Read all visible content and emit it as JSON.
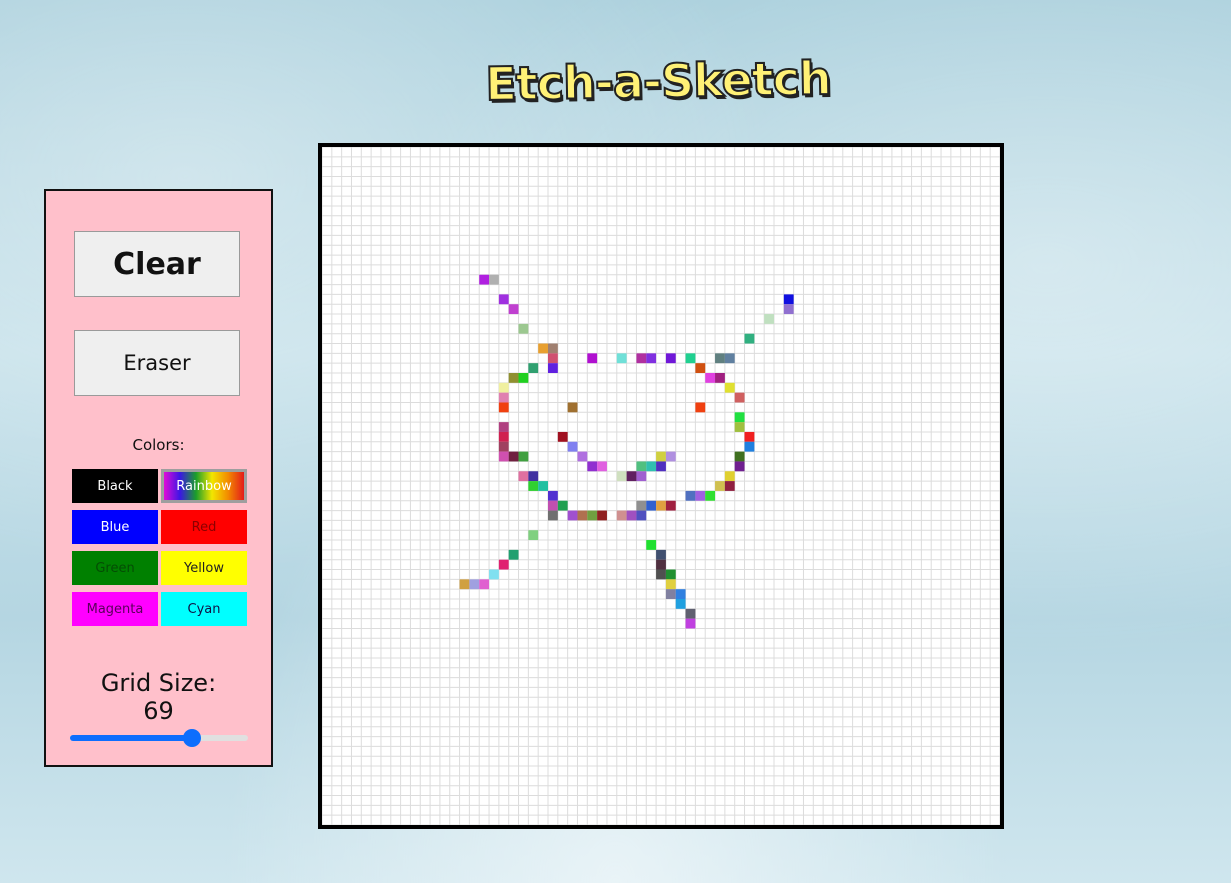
{
  "title": "Etch-a-Sketch",
  "controls": {
    "clear_label": "Clear",
    "eraser_label": "Eraser",
    "colors_label": "Colors:",
    "swatches": [
      {
        "label": "Black",
        "color": "#000000"
      },
      {
        "label": "Rainbow",
        "color": "rainbow"
      },
      {
        "label": "Blue",
        "color": "#0000ff"
      },
      {
        "label": "Red",
        "color": "#ff0000"
      },
      {
        "label": "Green",
        "color": "#008000"
      },
      {
        "label": "Yellow",
        "color": "#ffff00"
      },
      {
        "label": "Magenta",
        "color": "#ff00ff"
      },
      {
        "label": "Cyan",
        "color": "#00ffff"
      }
    ],
    "grid_size_label": "Grid Size:",
    "grid_size_value": "69",
    "slider": {
      "min": 1,
      "max": 100,
      "value": 69
    }
  },
  "board": {
    "grid_size": 69,
    "grid_line_color": "#dcdcdc",
    "painted_cells": [
      [
        16,
        13,
        "#b020e0"
      ],
      [
        17,
        13,
        "#b0b0b0"
      ],
      [
        18,
        15,
        "#a030e0"
      ],
      [
        19,
        16,
        "#c040d0"
      ],
      [
        20,
        18,
        "#9cc890"
      ],
      [
        22,
        20,
        "#e8a030"
      ],
      [
        23,
        20,
        "#a08070"
      ],
      [
        23,
        21,
        "#d05070"
      ],
      [
        27,
        21,
        "#b010d0"
      ],
      [
        30,
        21,
        "#70e0d8"
      ],
      [
        32,
        21,
        "#b030a0"
      ],
      [
        33,
        21,
        "#8030e0"
      ],
      [
        35,
        21,
        "#7018d8"
      ],
      [
        37,
        21,
        "#20d090"
      ],
      [
        40,
        21,
        "#608080"
      ],
      [
        41,
        21,
        "#6080a0"
      ],
      [
        21,
        22,
        "#30a070"
      ],
      [
        23,
        22,
        "#6020e0"
      ],
      [
        38,
        22,
        "#d05010"
      ],
      [
        19,
        23,
        "#909030"
      ],
      [
        20,
        23,
        "#20d020"
      ],
      [
        39,
        23,
        "#e040e0"
      ],
      [
        40,
        23,
        "#a02080"
      ],
      [
        18,
        24,
        "#f0f0a0"
      ],
      [
        41,
        24,
        "#e0e030"
      ],
      [
        18,
        25,
        "#e080b0"
      ],
      [
        42,
        25,
        "#d06060"
      ],
      [
        18,
        26,
        "#f04010"
      ],
      [
        25,
        26,
        "#a07030"
      ],
      [
        38,
        26,
        "#f04010"
      ],
      [
        42,
        27,
        "#20e040"
      ],
      [
        18,
        28,
        "#b04080"
      ],
      [
        42,
        28,
        "#a0c040"
      ],
      [
        18,
        29,
        "#d02050"
      ],
      [
        24,
        29,
        "#a01020"
      ],
      [
        43,
        29,
        "#f02020"
      ],
      [
        18,
        30,
        "#a04060"
      ],
      [
        25,
        30,
        "#8080f0"
      ],
      [
        43,
        30,
        "#2080e0"
      ],
      [
        18,
        31,
        "#d050b0"
      ],
      [
        19,
        31,
        "#702040"
      ],
      [
        20,
        31,
        "#40a040"
      ],
      [
        26,
        31,
        "#b070e0"
      ],
      [
        34,
        31,
        "#d0d040"
      ],
      [
        35,
        31,
        "#b090e0"
      ],
      [
        42,
        31,
        "#407020"
      ],
      [
        27,
        32,
        "#9030d0"
      ],
      [
        28,
        32,
        "#e060e0"
      ],
      [
        32,
        32,
        "#50c080"
      ],
      [
        33,
        32,
        "#30c0b0"
      ],
      [
        34,
        32,
        "#5030c0"
      ],
      [
        42,
        32,
        "#702090"
      ],
      [
        20,
        33,
        "#e070a0"
      ],
      [
        21,
        33,
        "#4030a0"
      ],
      [
        30,
        33,
        "#d0e0c0"
      ],
      [
        31,
        33,
        "#602060"
      ],
      [
        32,
        33,
        "#a060d0"
      ],
      [
        41,
        33,
        "#e0d030"
      ],
      [
        21,
        34,
        "#30d030"
      ],
      [
        22,
        34,
        "#20c0a0"
      ],
      [
        40,
        34,
        "#d0c050"
      ],
      [
        41,
        34,
        "#902040"
      ],
      [
        23,
        35,
        "#5030d0"
      ],
      [
        37,
        35,
        "#5070c0"
      ],
      [
        38,
        35,
        "#a060e0"
      ],
      [
        39,
        35,
        "#30e030"
      ],
      [
        23,
        36,
        "#c050b0"
      ],
      [
        24,
        36,
        "#20a050"
      ],
      [
        32,
        36,
        "#909090"
      ],
      [
        33,
        36,
        "#3060d0"
      ],
      [
        34,
        36,
        "#e0a040"
      ],
      [
        35,
        36,
        "#a02040"
      ],
      [
        23,
        37,
        "#707070"
      ],
      [
        25,
        37,
        "#a050d0"
      ],
      [
        26,
        37,
        "#b07050"
      ],
      [
        27,
        37,
        "#70a040"
      ],
      [
        28,
        37,
        "#902020"
      ],
      [
        30,
        37,
        "#d09090"
      ],
      [
        31,
        37,
        "#a050c0"
      ],
      [
        32,
        37,
        "#5050c0"
      ],
      [
        21,
        39,
        "#80d080"
      ],
      [
        33,
        40,
        "#20e030"
      ],
      [
        19,
        41,
        "#20a070"
      ],
      [
        34,
        41,
        "#405070"
      ],
      [
        18,
        42,
        "#e02070"
      ],
      [
        34,
        42,
        "#503040"
      ],
      [
        17,
        43,
        "#80e0f0"
      ],
      [
        34,
        43,
        "#505050"
      ],
      [
        35,
        43,
        "#209030"
      ],
      [
        14,
        44,
        "#d0a040"
      ],
      [
        15,
        44,
        "#a0a0e0"
      ],
      [
        16,
        44,
        "#e060d0"
      ],
      [
        35,
        44,
        "#e0d040"
      ],
      [
        35,
        45,
        "#8080a0"
      ],
      [
        36,
        45,
        "#3080e0"
      ],
      [
        36,
        46,
        "#20a0e0"
      ],
      [
        37,
        47,
        "#606070"
      ],
      [
        37,
        48,
        "#c040e0"
      ],
      [
        47,
        15,
        "#1010e0"
      ],
      [
        47,
        16,
        "#9070d0"
      ],
      [
        45,
        17,
        "#c0e0c0"
      ],
      [
        43,
        19,
        "#30b080"
      ]
    ]
  }
}
